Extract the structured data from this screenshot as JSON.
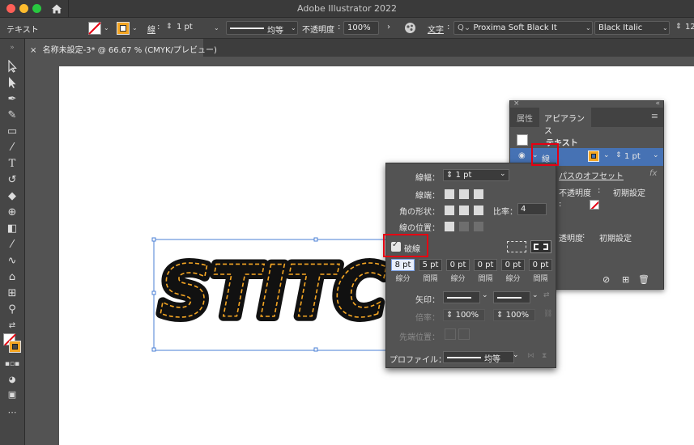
{
  "window": {
    "title": "Adobe Illustrator 2022"
  },
  "colors": {
    "accent_orange": "#f5a623",
    "highlight_red": "#e60012",
    "selection_blue": "#4a7fd6",
    "panel_bg": "#535353"
  },
  "control_bar": {
    "object_type": "テキスト",
    "stroke_label": "線",
    "stroke_weight": "1 pt",
    "profile_label": "均等",
    "opacity_label": "不透明度",
    "opacity_value": "100%",
    "character_label": "文字",
    "font_family": "Proxima Soft Black It",
    "font_style": "Black Italic",
    "font_size_partial": "12"
  },
  "document_tab": {
    "label": "名称未設定-3* @ 66.67 % (CMYK/プレビュー)"
  },
  "canvas": {
    "artwork_text": "STITC"
  },
  "appearance_panel": {
    "tabs": [
      "属性",
      "アピアランス"
    ],
    "rows": {
      "object": "テキスト",
      "stroke": "線",
      "stroke_weight": "1 pt",
      "offset_path": "パスのオフセット",
      "fx": "fx",
      "opacity_label": "不透明度",
      "opacity_value": "初期設定",
      "opacity2_label": "透明度",
      "opacity2_value": "初期設定"
    }
  },
  "stroke_panel": {
    "weight_label": "線幅",
    "weight_value": "1 pt",
    "cap_label": "線端",
    "corner_label": "角の形状",
    "limit_label": "比率",
    "limit_value": "4",
    "align_label": "線の位置",
    "dashed_label": "破線",
    "dash_values": [
      "8 pt",
      "5 pt",
      "0 pt",
      "0 pt",
      "0 pt",
      "0 pt"
    ],
    "dash_labels": [
      "線分",
      "間隔",
      "線分",
      "間隔",
      "線分",
      "間隔"
    ],
    "arrow_label": "矢印",
    "scale_label": "倍率",
    "scale_value_1": "100%",
    "scale_value_2": "100%",
    "align_arrow_label": "先端位置",
    "profile_label": "プロファイル",
    "profile_value": "均等"
  }
}
